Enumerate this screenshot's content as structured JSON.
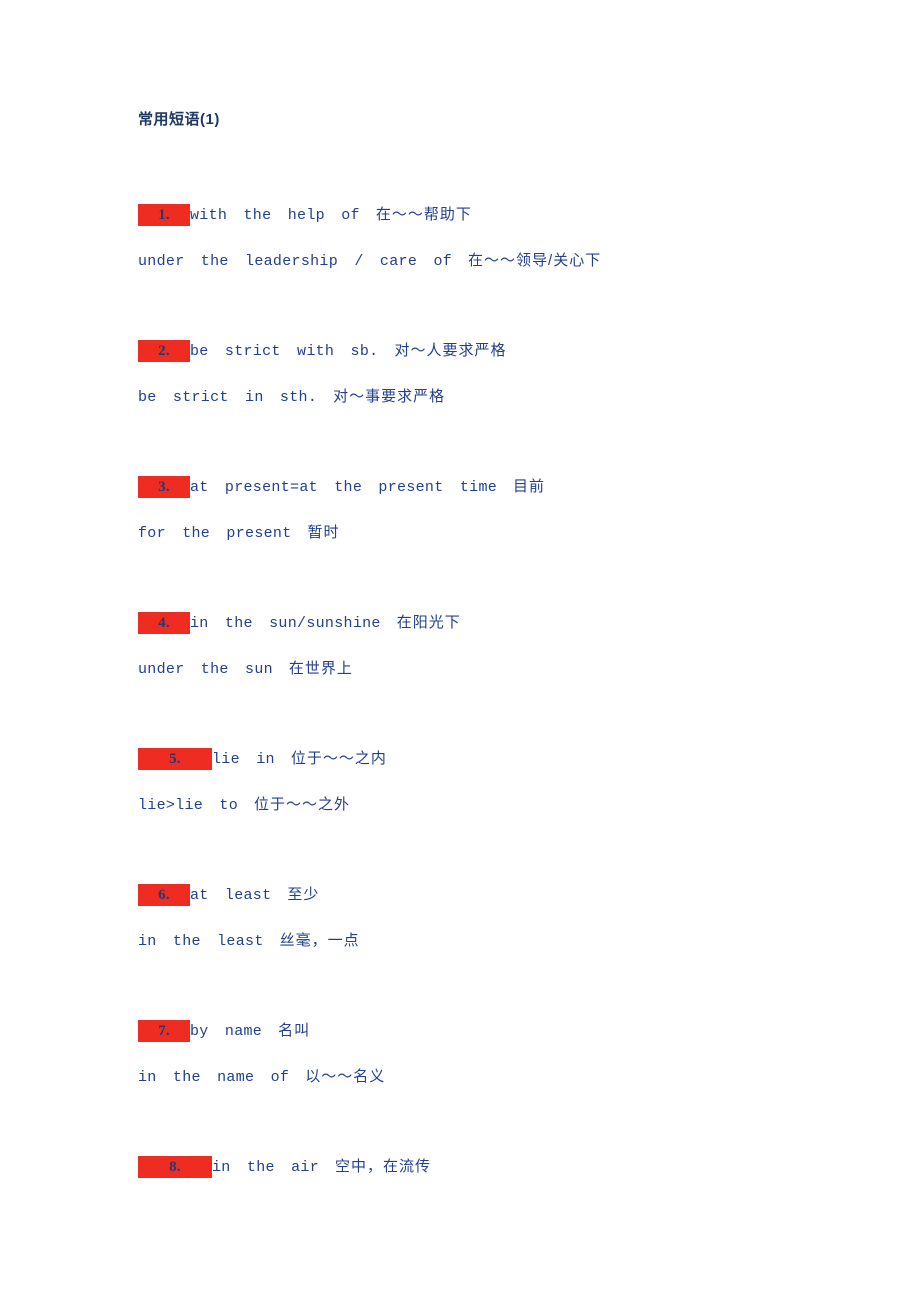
{
  "document": {
    "title": "常用短语(1)",
    "text_color": "#23408e",
    "highlight_color": "#ee2c21",
    "background": "#ffffff"
  },
  "entries": [
    {
      "number": "1.",
      "badge_width": "narrow",
      "line1_en": "with  the  help  of",
      "line1_cn": "在～～帮助下",
      "line2_en": "under  the  leadership  /  care  of",
      "line2_cn": "在～～领导/关心下"
    },
    {
      "number": "2.",
      "badge_width": "narrow",
      "line1_en": "be  strict  with  sb.",
      "line1_cn": "对～人要求严格",
      "line2_en": "be  strict  in  sth.",
      "line2_cn": "对～事要求严格"
    },
    {
      "number": "3.",
      "badge_width": "narrow",
      "line1_en": "at  present=at  the  present  time",
      "line1_cn": "目前",
      "line2_en": "for  the  present",
      "line2_cn": "暂时"
    },
    {
      "number": "4.",
      "badge_width": "narrow",
      "line1_en": "in  the  sun/sunshine",
      "line1_cn": "在阳光下",
      "line2_en": "under  the  sun",
      "line2_cn": "在世界上"
    },
    {
      "number": "5.",
      "badge_width": "wide",
      "line1_en": "lie  in",
      "line1_cn": "位于～～之内",
      "line2_en": "lie>lie  to",
      "line2_cn": "位于～～之外"
    },
    {
      "number": "6.",
      "badge_width": "narrow",
      "line1_en": "at  least",
      "line1_cn": "至少",
      "line2_en": "in  the  least",
      "line2_cn": "丝毫，一点"
    },
    {
      "number": "7.",
      "badge_width": "narrow",
      "line1_en": "by  name",
      "line1_cn": "名叫",
      "line2_en": "in  the  name  of",
      "line2_cn": "以～～名义"
    },
    {
      "number": "8.",
      "badge_width": "wide",
      "line1_en": "in  the  air",
      "line1_cn": "空中，在流传",
      "line2_en": "",
      "line2_cn": ""
    }
  ]
}
